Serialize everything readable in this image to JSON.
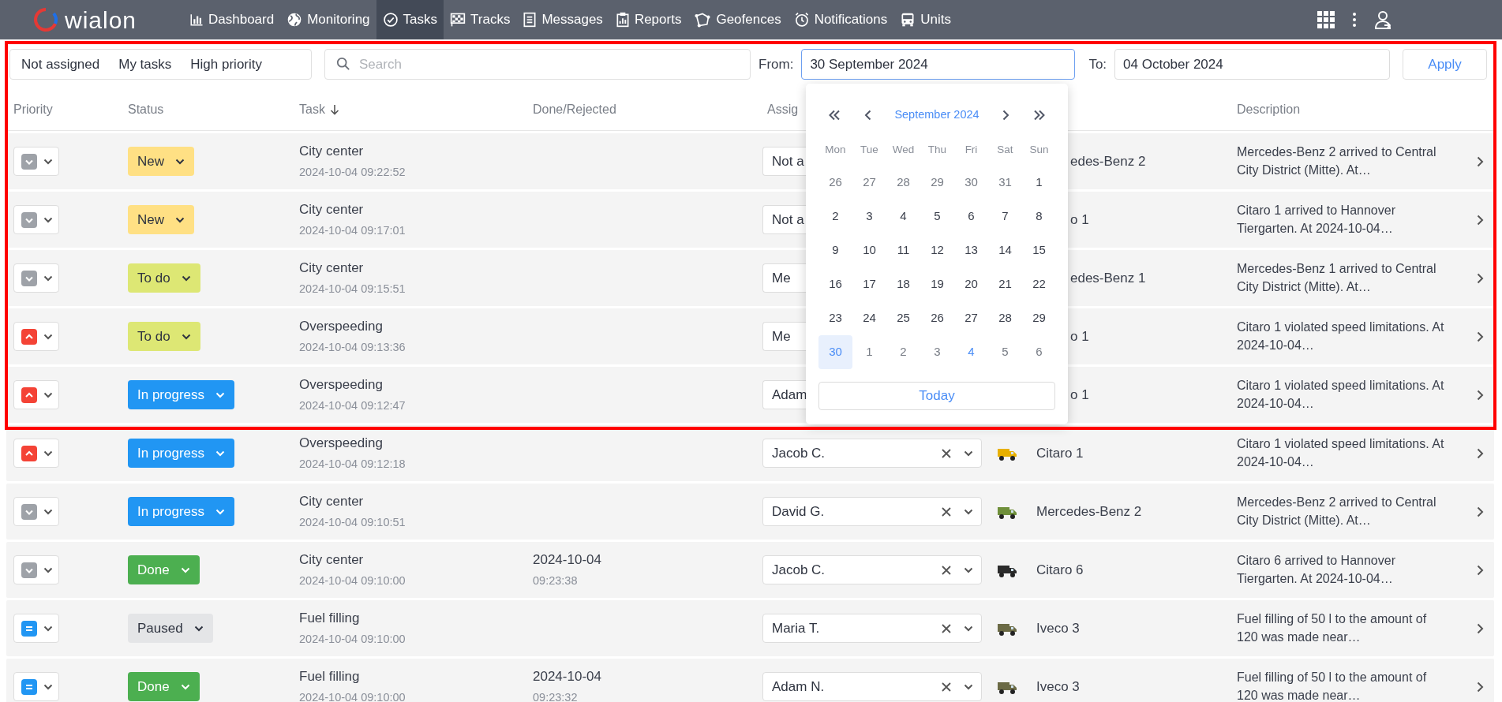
{
  "navbar": {
    "logo": "wialon",
    "items": [
      {
        "label": "Dashboard",
        "selected": false
      },
      {
        "label": "Monitoring",
        "selected": false
      },
      {
        "label": "Tasks",
        "selected": true
      },
      {
        "label": "Tracks",
        "selected": false
      },
      {
        "label": "Messages",
        "selected": false
      },
      {
        "label": "Reports",
        "selected": false
      },
      {
        "label": "Geofences",
        "selected": false
      },
      {
        "label": "Notifications",
        "selected": false
      },
      {
        "label": "Units",
        "selected": false
      }
    ]
  },
  "filters": {
    "quick": [
      "Not assigned",
      "My tasks",
      "High priority"
    ],
    "search": {
      "placeholder": "Search"
    },
    "from": {
      "label": "From:",
      "value": "30 September 2024",
      "focused": true
    },
    "to": {
      "label": "To:",
      "value": "04 October 2024",
      "focused": false
    },
    "apply": "Apply"
  },
  "table": {
    "columns": [
      {
        "label": "Priority"
      },
      {
        "label": "Status"
      },
      {
        "label": "Task",
        "sorted": true
      },
      {
        "label": "Done/Rejected"
      },
      {
        "label": "Assig"
      },
      {
        "label": "Description"
      }
    ],
    "rows": [
      {
        "priority": {
          "kind": "low"
        },
        "status": {
          "label": "New",
          "kind": "new"
        },
        "task": "City center",
        "created": "2024-10-04 09:22:52",
        "assignee": {
          "value": "Not a",
          "clipped": true
        },
        "unit": {
          "name": "edes-Benz 2"
        },
        "description": "Mercedes-Benz 2 arrived to Central City District (Mitte). At…"
      },
      {
        "priority": {
          "kind": "low"
        },
        "status": {
          "label": "New",
          "kind": "new"
        },
        "task": "City center",
        "created": "2024-10-04 09:17:01",
        "assignee": {
          "value": "Not a",
          "clipped": true
        },
        "unit": {
          "name": "o 1"
        },
        "description": "Citaro 1 arrived to Hannover Tiergarten. At 2024-10-04…"
      },
      {
        "priority": {
          "kind": "low"
        },
        "status": {
          "label": "To do",
          "kind": "todo"
        },
        "task": "City center",
        "created": "2024-10-04 09:15:51",
        "assignee": {
          "value": "Me",
          "clipped": true
        },
        "unit": {
          "name": "edes-Benz 1"
        },
        "description": "Mercedes-Benz 1 arrived to Central City District (Mitte). At…"
      },
      {
        "priority": {
          "kind": "high"
        },
        "status": {
          "label": "To do",
          "kind": "todo"
        },
        "task": "Overspeeding",
        "created": "2024-10-04 09:13:36",
        "assignee": {
          "value": "Me",
          "clipped": true
        },
        "unit": {
          "name": "o 1"
        },
        "description": "Citaro 1 violated speed limitations. At 2024-10-04…"
      },
      {
        "priority": {
          "kind": "high"
        },
        "status": {
          "label": "In progress",
          "kind": "progress"
        },
        "task": "Overspeeding",
        "created": "2024-10-04 09:12:47",
        "assignee": {
          "value": "Adam",
          "clipped": true
        },
        "unit": {
          "name": "o 1"
        },
        "description": "Citaro 1 violated speed limitations. At 2024-10-04…"
      },
      {
        "priority": {
          "kind": "high"
        },
        "status": {
          "label": "In progress",
          "kind": "progress"
        },
        "task": "Overspeeding",
        "created": "2024-10-04 09:12:18",
        "assignee": {
          "value": "Jacob C.",
          "clipped": false
        },
        "unit": {
          "name": "Citaro 1",
          "color": "#e8b000"
        },
        "description": "Citaro 1 violated speed limitations. At 2024-10-04…"
      },
      {
        "priority": {
          "kind": "low"
        },
        "status": {
          "label": "In progress",
          "kind": "progress"
        },
        "task": "City center",
        "created": "2024-10-04 09:10:51",
        "assignee": {
          "value": "David G.",
          "clipped": false
        },
        "unit": {
          "name": "Mercedes-Benz 2",
          "color": "#6f8f3a"
        },
        "description": "Mercedes-Benz 2 arrived to Central City District (Mitte). At…"
      },
      {
        "priority": {
          "kind": "low"
        },
        "status": {
          "label": "Done",
          "kind": "done"
        },
        "task": "City center",
        "created": "2024-10-04 09:10:00",
        "done": {
          "date": "2024-10-04",
          "time": "09:23:38"
        },
        "assignee": {
          "value": "Jacob C.",
          "clipped": false
        },
        "unit": {
          "name": "Citaro 6",
          "color": "#2b2b2b"
        },
        "description": "Citaro 6 arrived to Hannover Tiergarten. At 2024-10-04…"
      },
      {
        "priority": {
          "kind": "normal"
        },
        "status": {
          "label": "Paused",
          "kind": "paused"
        },
        "task": "Fuel filling",
        "created": "2024-10-04 09:10:00",
        "assignee": {
          "value": "Maria T.",
          "clipped": false
        },
        "unit": {
          "name": "Iveco 3",
          "color": "#6b6a45"
        },
        "description": "Fuel filling of 50 l to the amount of 120 was made near…"
      },
      {
        "priority": {
          "kind": "normal"
        },
        "status": {
          "label": "Done",
          "kind": "done"
        },
        "task": "Fuel filling",
        "created": "2024-10-04 09:10:00",
        "done": {
          "date": "2024-10-04",
          "time": "09:23:32"
        },
        "assignee": {
          "value": "Adam N.",
          "clipped": false
        },
        "unit": {
          "name": "Iveco 3",
          "color": "#6b6a45"
        },
        "description": "Fuel filling of 50 l to the amount of 120 was made near…"
      }
    ]
  },
  "calendar": {
    "title": "September 2024",
    "weekdays": [
      "Mon",
      "Tue",
      "Wed",
      "Thu",
      "Fri",
      "Sat",
      "Sun"
    ],
    "weeks": [
      [
        {
          "day": "26",
          "other": true,
          "selected": false,
          "today": false
        },
        {
          "day": "27",
          "other": true,
          "selected": false,
          "today": false
        },
        {
          "day": "28",
          "other": true,
          "selected": false,
          "today": false
        },
        {
          "day": "29",
          "other": true,
          "selected": false,
          "today": false
        },
        {
          "day": "30",
          "other": true,
          "selected": false,
          "today": false
        },
        {
          "day": "31",
          "other": true,
          "selected": false,
          "today": false
        },
        {
          "day": "1",
          "other": false,
          "selected": false,
          "today": false
        }
      ],
      [
        {
          "day": "2",
          "other": false,
          "selected": false,
          "today": false
        },
        {
          "day": "3",
          "other": false,
          "selected": false,
          "today": false
        },
        {
          "day": "4",
          "other": false,
          "selected": false,
          "today": false
        },
        {
          "day": "5",
          "other": false,
          "selected": false,
          "today": false
        },
        {
          "day": "6",
          "other": false,
          "selected": false,
          "today": false
        },
        {
          "day": "7",
          "other": false,
          "selected": false,
          "today": false
        },
        {
          "day": "8",
          "other": false,
          "selected": false,
          "today": false
        }
      ],
      [
        {
          "day": "9",
          "other": false,
          "selected": false,
          "today": false
        },
        {
          "day": "10",
          "other": false,
          "selected": false,
          "today": false
        },
        {
          "day": "11",
          "other": false,
          "selected": false,
          "today": false
        },
        {
          "day": "12",
          "other": false,
          "selected": false,
          "today": false
        },
        {
          "day": "13",
          "other": false,
          "selected": false,
          "today": false
        },
        {
          "day": "14",
          "other": false,
          "selected": false,
          "today": false
        },
        {
          "day": "15",
          "other": false,
          "selected": false,
          "today": false
        }
      ],
      [
        {
          "day": "16",
          "other": false,
          "selected": false,
          "today": false
        },
        {
          "day": "17",
          "other": false,
          "selected": false,
          "today": false
        },
        {
          "day": "18",
          "other": false,
          "selected": false,
          "today": false
        },
        {
          "day": "19",
          "other": false,
          "selected": false,
          "today": false
        },
        {
          "day": "20",
          "other": false,
          "selected": false,
          "today": false
        },
        {
          "day": "21",
          "other": false,
          "selected": false,
          "today": false
        },
        {
          "day": "22",
          "other": false,
          "selected": false,
          "today": false
        }
      ],
      [
        {
          "day": "23",
          "other": false,
          "selected": false,
          "today": false
        },
        {
          "day": "24",
          "other": false,
          "selected": false,
          "today": false
        },
        {
          "day": "25",
          "other": false,
          "selected": false,
          "today": false
        },
        {
          "day": "26",
          "other": false,
          "selected": false,
          "today": false
        },
        {
          "day": "27",
          "other": false,
          "selected": false,
          "today": false
        },
        {
          "day": "28",
          "other": false,
          "selected": false,
          "today": false
        },
        {
          "day": "29",
          "other": false,
          "selected": false,
          "today": false
        }
      ],
      [
        {
          "day": "30",
          "other": false,
          "selected": true,
          "today": false
        },
        {
          "day": "1",
          "other": true,
          "selected": false,
          "today": false
        },
        {
          "day": "2",
          "other": true,
          "selected": false,
          "today": false
        },
        {
          "day": "3",
          "other": true,
          "selected": false,
          "today": false
        },
        {
          "day": "4",
          "other": true,
          "selected": false,
          "today": true
        },
        {
          "day": "5",
          "other": true,
          "selected": false,
          "today": false
        },
        {
          "day": "6",
          "other": true,
          "selected": false,
          "today": false
        }
      ]
    ],
    "today_button": "Today"
  }
}
